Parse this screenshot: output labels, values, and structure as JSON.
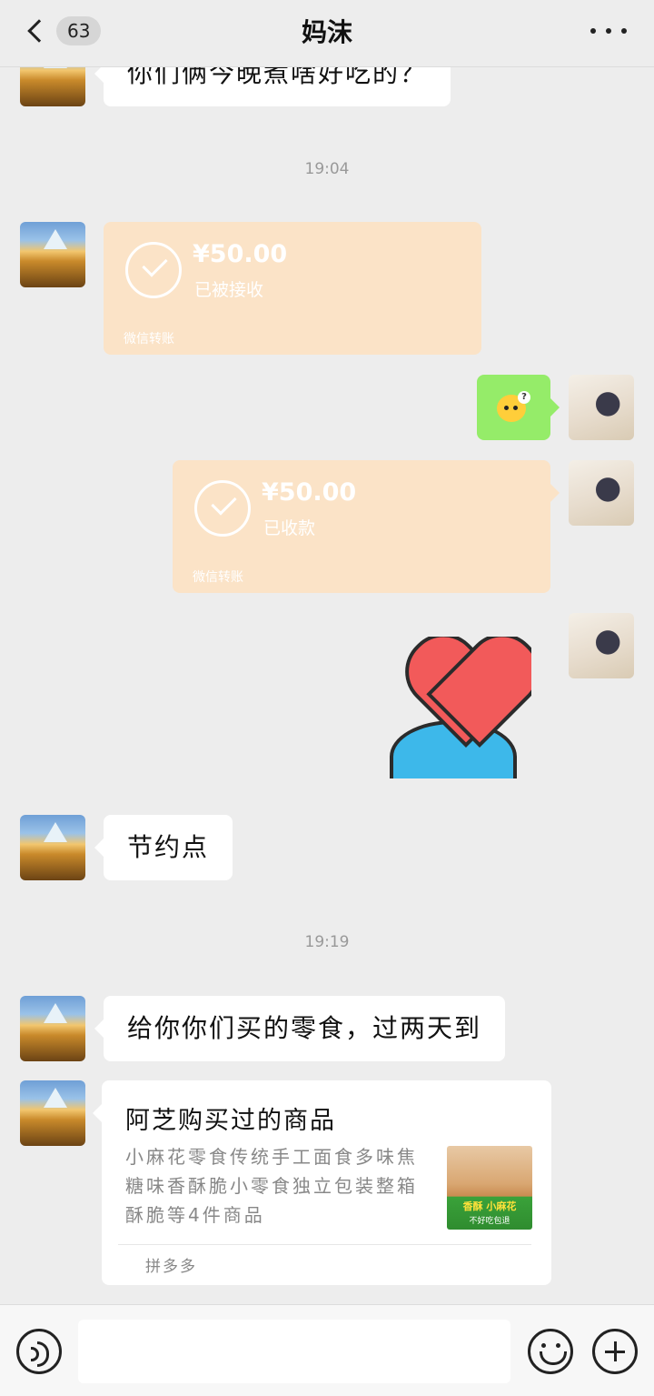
{
  "header": {
    "unread_count": "63",
    "title": "妈沫"
  },
  "messages": {
    "m1_text": "你们俩今晚煮啥好吃的？",
    "time1": "19:04",
    "transfer_in": {
      "amount": "¥50.00",
      "status": "已被接收",
      "footer": "微信转账"
    },
    "transfer_out": {
      "amount": "¥50.00",
      "status": "已收款",
      "footer": "微信转账"
    },
    "m2_text": "节约点",
    "time2": "19:19",
    "m3_text": "给你你们买的零食，过两天到",
    "card": {
      "title": "阿芝购买过的商品",
      "desc": "小麻花零食传统手工面食多味焦糖味香酥脆小零食独立包装整箱酥脆等4件商品",
      "thumb_label": "香酥 小麻花",
      "thumb_sub": "不好吃包退",
      "source": "拼多多"
    }
  },
  "input": {
    "value": ""
  }
}
